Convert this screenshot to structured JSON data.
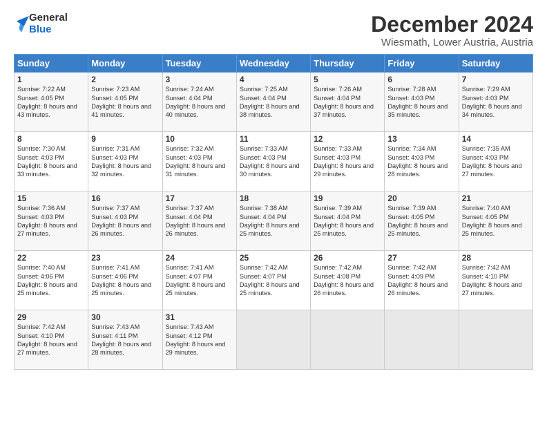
{
  "logo": {
    "general": "General",
    "blue": "Blue"
  },
  "title": "December 2024",
  "subtitle": "Wiesmath, Lower Austria, Austria",
  "header_days": [
    "Sunday",
    "Monday",
    "Tuesday",
    "Wednesday",
    "Thursday",
    "Friday",
    "Saturday"
  ],
  "weeks": [
    [
      {
        "day": "1",
        "sunrise": "7:22 AM",
        "sunset": "4:05 PM",
        "daylight": "8 hours and 43 minutes."
      },
      {
        "day": "2",
        "sunrise": "7:23 AM",
        "sunset": "4:05 PM",
        "daylight": "8 hours and 41 minutes."
      },
      {
        "day": "3",
        "sunrise": "7:24 AM",
        "sunset": "4:04 PM",
        "daylight": "8 hours and 40 minutes."
      },
      {
        "day": "4",
        "sunrise": "7:25 AM",
        "sunset": "4:04 PM",
        "daylight": "8 hours and 38 minutes."
      },
      {
        "day": "5",
        "sunrise": "7:26 AM",
        "sunset": "4:04 PM",
        "daylight": "8 hours and 37 minutes."
      },
      {
        "day": "6",
        "sunrise": "7:28 AM",
        "sunset": "4:03 PM",
        "daylight": "8 hours and 35 minutes."
      },
      {
        "day": "7",
        "sunrise": "7:29 AM",
        "sunset": "4:03 PM",
        "daylight": "8 hours and 34 minutes."
      }
    ],
    [
      {
        "day": "8",
        "sunrise": "7:30 AM",
        "sunset": "4:03 PM",
        "daylight": "8 hours and 33 minutes."
      },
      {
        "day": "9",
        "sunrise": "7:31 AM",
        "sunset": "4:03 PM",
        "daylight": "8 hours and 32 minutes."
      },
      {
        "day": "10",
        "sunrise": "7:32 AM",
        "sunset": "4:03 PM",
        "daylight": "8 hours and 31 minutes."
      },
      {
        "day": "11",
        "sunrise": "7:33 AM",
        "sunset": "4:03 PM",
        "daylight": "8 hours and 30 minutes."
      },
      {
        "day": "12",
        "sunrise": "7:33 AM",
        "sunset": "4:03 PM",
        "daylight": "8 hours and 29 minutes."
      },
      {
        "day": "13",
        "sunrise": "7:34 AM",
        "sunset": "4:03 PM",
        "daylight": "8 hours and 28 minutes."
      },
      {
        "day": "14",
        "sunrise": "7:35 AM",
        "sunset": "4:03 PM",
        "daylight": "8 hours and 27 minutes."
      }
    ],
    [
      {
        "day": "15",
        "sunrise": "7:36 AM",
        "sunset": "4:03 PM",
        "daylight": "8 hours and 27 minutes."
      },
      {
        "day": "16",
        "sunrise": "7:37 AM",
        "sunset": "4:03 PM",
        "daylight": "8 hours and 26 minutes."
      },
      {
        "day": "17",
        "sunrise": "7:37 AM",
        "sunset": "4:04 PM",
        "daylight": "8 hours and 26 minutes."
      },
      {
        "day": "18",
        "sunrise": "7:38 AM",
        "sunset": "4:04 PM",
        "daylight": "8 hours and 25 minutes."
      },
      {
        "day": "19",
        "sunrise": "7:39 AM",
        "sunset": "4:04 PM",
        "daylight": "8 hours and 25 minutes."
      },
      {
        "day": "20",
        "sunrise": "7:39 AM",
        "sunset": "4:05 PM",
        "daylight": "8 hours and 25 minutes."
      },
      {
        "day": "21",
        "sunrise": "7:40 AM",
        "sunset": "4:05 PM",
        "daylight": "8 hours and 25 minutes."
      }
    ],
    [
      {
        "day": "22",
        "sunrise": "7:40 AM",
        "sunset": "4:06 PM",
        "daylight": "8 hours and 25 minutes."
      },
      {
        "day": "23",
        "sunrise": "7:41 AM",
        "sunset": "4:06 PM",
        "daylight": "8 hours and 25 minutes."
      },
      {
        "day": "24",
        "sunrise": "7:41 AM",
        "sunset": "4:07 PM",
        "daylight": "8 hours and 25 minutes."
      },
      {
        "day": "25",
        "sunrise": "7:42 AM",
        "sunset": "4:07 PM",
        "daylight": "8 hours and 25 minutes."
      },
      {
        "day": "26",
        "sunrise": "7:42 AM",
        "sunset": "4:08 PM",
        "daylight": "8 hours and 26 minutes."
      },
      {
        "day": "27",
        "sunrise": "7:42 AM",
        "sunset": "4:09 PM",
        "daylight": "8 hours and 26 minutes."
      },
      {
        "day": "28",
        "sunrise": "7:42 AM",
        "sunset": "4:10 PM",
        "daylight": "8 hours and 27 minutes."
      }
    ],
    [
      {
        "day": "29",
        "sunrise": "7:42 AM",
        "sunset": "4:10 PM",
        "daylight": "8 hours and 27 minutes."
      },
      {
        "day": "30",
        "sunrise": "7:43 AM",
        "sunset": "4:11 PM",
        "daylight": "8 hours and 28 minutes."
      },
      {
        "day": "31",
        "sunrise": "7:43 AM",
        "sunset": "4:12 PM",
        "daylight": "8 hours and 29 minutes."
      },
      null,
      null,
      null,
      null
    ]
  ],
  "labels": {
    "sunrise": "Sunrise:",
    "sunset": "Sunset:",
    "daylight": "Daylight:"
  }
}
